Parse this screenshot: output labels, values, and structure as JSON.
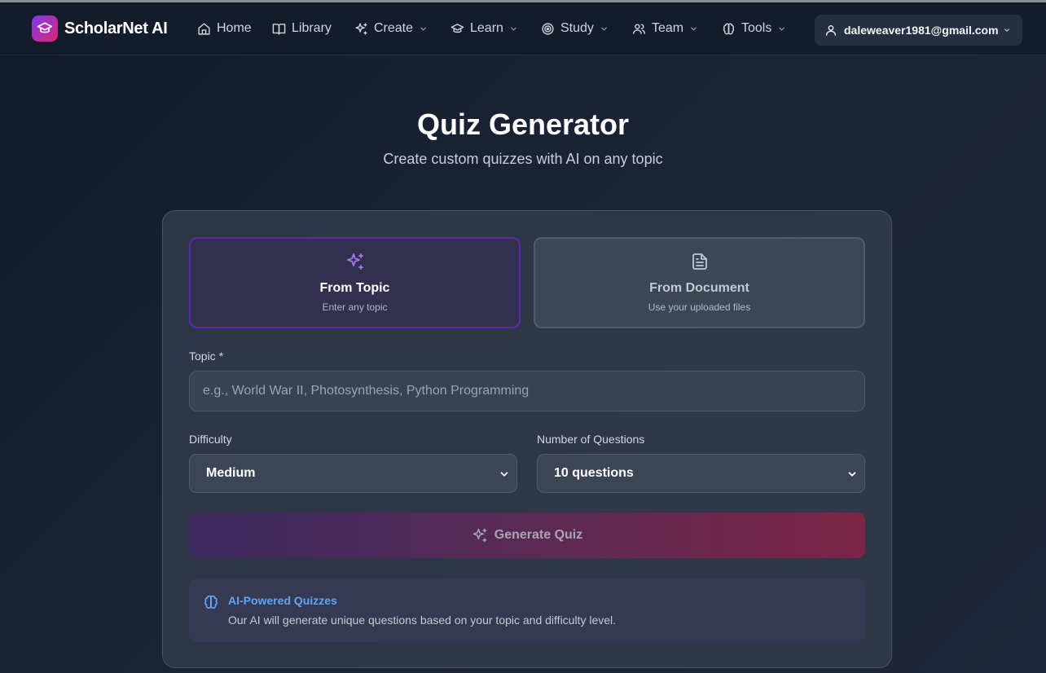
{
  "app": {
    "name": "ScholarNet AI"
  },
  "nav": {
    "items": [
      {
        "label": "Home",
        "icon": "home-icon"
      },
      {
        "label": "Library",
        "icon": "book-icon"
      },
      {
        "label": "Create",
        "icon": "sparkles-icon",
        "dropdown": true
      },
      {
        "label": "Learn",
        "icon": "graduation-cap-icon",
        "dropdown": true
      },
      {
        "label": "Study",
        "icon": "target-icon",
        "dropdown": true
      },
      {
        "label": "Team",
        "icon": "users-icon",
        "dropdown": true
      },
      {
        "label": "Tools",
        "icon": "brain-icon",
        "dropdown": true
      }
    ],
    "user_email": "daleweaver1981@gmail.com"
  },
  "page": {
    "title": "Quiz Generator",
    "subtitle": "Create custom quizzes with AI on any topic"
  },
  "modes": {
    "topic": {
      "title": "From Topic",
      "subtitle": "Enter any topic",
      "selected": true
    },
    "document": {
      "title": "From Document",
      "subtitle": "Use your uploaded files",
      "selected": false
    }
  },
  "form": {
    "topic_label": "Topic *",
    "topic_value": "",
    "topic_placeholder": "e.g., World War II, Photosynthesis, Python Programming",
    "difficulty_label": "Difficulty",
    "difficulty_value": "Medium",
    "questions_label": "Number of Questions",
    "questions_value": "10 questions",
    "generate_label": "Generate Quiz"
  },
  "info": {
    "title": "AI-Powered Quizzes",
    "text": "Our AI will generate unique questions based on your topic and difficulty level."
  },
  "colors": {
    "background": "#1a2233",
    "accent_purple": "#7c3aed",
    "accent_pink": "#db2777",
    "info_blue": "#60a5fa"
  }
}
